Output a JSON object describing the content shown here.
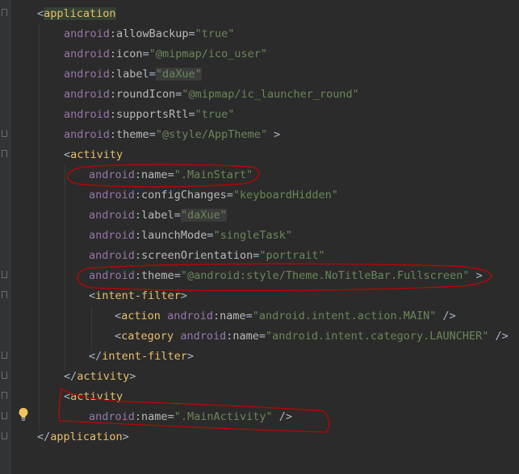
{
  "lines": {
    "l1": {
      "open": "<",
      "tag": "application"
    },
    "l2": {
      "ns": "android",
      "colon": ":",
      "attr": "allowBackup",
      "eq": "=",
      "val": "\"true\""
    },
    "l3": {
      "ns": "android",
      "colon": ":",
      "attr": "icon",
      "eq": "=",
      "val": "\"@mipmap/ico_user\""
    },
    "l4": {
      "ns": "android",
      "colon": ":",
      "attr": "label",
      "eq": "=",
      "val": "\"daXue\""
    },
    "l5": {
      "ns": "android",
      "colon": ":",
      "attr": "roundIcon",
      "eq": "=",
      "val": "\"@mipmap/ic_launcher_round\""
    },
    "l6": {
      "ns": "android",
      "colon": ":",
      "attr": "supportsRtl",
      "eq": "=",
      "val": "\"true\""
    },
    "l7": {
      "ns": "android",
      "colon": ":",
      "attr": "theme",
      "eq": "=",
      "val": "\"@style/AppTheme\"",
      "close": " >"
    },
    "l8": {
      "open": "<",
      "tag": "activity"
    },
    "l9": {
      "ns": "android",
      "colon": ":",
      "attr": "name",
      "eq": "=",
      "val": "\".MainStart\""
    },
    "l10": {
      "ns": "android",
      "colon": ":",
      "attr": "configChanges",
      "eq": "=",
      "val": "\"keyboardHidden\""
    },
    "l11": {
      "ns": "android",
      "colon": ":",
      "attr": "label",
      "eq": "=",
      "val": "\"daXue\""
    },
    "l12": {
      "ns": "android",
      "colon": ":",
      "attr": "launchMode",
      "eq": "=",
      "val": "\"singleTask\""
    },
    "l13": {
      "ns": "android",
      "colon": ":",
      "attr": "screenOrientation",
      "eq": "=",
      "val": "\"portrait\""
    },
    "l14": {
      "ns": "android",
      "colon": ":",
      "attr": "theme",
      "eq": "=",
      "val": "\"@android:style/Theme.NoTitleBar.Fullscreen\"",
      "close": " >"
    },
    "l15": {
      "open": "<",
      "tag": "intent-filter",
      "close": ">"
    },
    "l16": {
      "open": "<",
      "tag": "action",
      "space": " ",
      "ns": "android",
      "colon": ":",
      "attr": "name",
      "eq": "=",
      "val": "\"android.intent.action.MAIN\"",
      "close": " />"
    },
    "l17": {
      "open": "<",
      "tag": "category",
      "space": " ",
      "ns": "android",
      "colon": ":",
      "attr": "name",
      "eq": "=",
      "val": "\"android.intent.category.LAUNCHER\"",
      "close": " />"
    },
    "l18": {
      "open": "</",
      "tag": "intent-filter",
      "close": ">"
    },
    "l19": {
      "open": "</",
      "tag": "activity",
      "close": ">"
    },
    "l20": {
      "open": "<",
      "tag": "activity"
    },
    "l21": {
      "ns": "android",
      "colon": ":",
      "attr": "name",
      "eq": "=",
      "val": "\".MainActivity\"",
      "close": " />"
    },
    "l22": {
      "open": "</",
      "tag": "application",
      "close": ">"
    }
  },
  "colors": {
    "background": "#2b2b2b",
    "tag": "#e8bf6a",
    "namespace": "#9876aa",
    "attribute": "#bababa",
    "string": "#6a8759",
    "annotation": "#cc0000",
    "bulb": "#f2c55c"
  },
  "icons": {
    "intention": "lightbulb-icon"
  }
}
